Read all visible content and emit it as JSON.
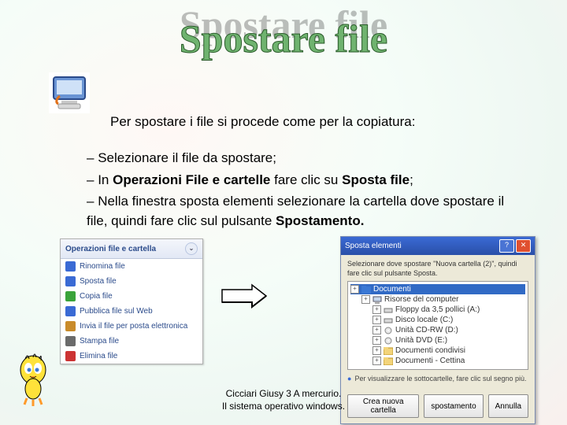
{
  "title": "Spostare file",
  "intro": "Per spostare i file si procede come per la copiatura:",
  "bullets": [
    "Selezionare il file da spostare;",
    "In <b>Operazioni File e cartelle</b> fare clic su <b>Sposta file</b>;",
    "Nella finestra sposta elementi selezionare la cartella dove spostare il file, quindi fare clic sul pulsante <b>Spostamento.</b>"
  ],
  "operations_panel": {
    "title": "Operazioni file e cartella",
    "items": [
      {
        "label": "Rinomina file",
        "color": "#3a6ad4"
      },
      {
        "label": "Sposta file",
        "color": "#3a6ad4"
      },
      {
        "label": "Copia file",
        "color": "#3aa33a"
      },
      {
        "label": "Pubblica file sul Web",
        "color": "#3a6ad4"
      },
      {
        "label": "Invia il file per posta elettronica",
        "color": "#c98b2a"
      },
      {
        "label": "Stampa file",
        "color": "#6a6a6a"
      },
      {
        "label": "Elimina file",
        "color": "#cc3333"
      }
    ]
  },
  "move_dialog": {
    "title": "Sposta elementi",
    "instruction": "Selezionare dove spostare \"Nuova cartella (2)\", quindi fare clic sul pulsante Sposta.",
    "tree": [
      {
        "label": "Documenti",
        "indent": 0,
        "selected": true,
        "icon": "folder-blue"
      },
      {
        "label": "Risorse del computer",
        "indent": 1,
        "icon": "computer"
      },
      {
        "label": "Floppy da 3,5 pollici (A:)",
        "indent": 2,
        "icon": "drive"
      },
      {
        "label": "Disco locale (C:)",
        "indent": 2,
        "icon": "drive"
      },
      {
        "label": "Unità CD-RW (D:)",
        "indent": 2,
        "icon": "cd"
      },
      {
        "label": "Unità DVD (E:)",
        "indent": 2,
        "icon": "cd"
      },
      {
        "label": "Documenti condivisi",
        "indent": 2,
        "icon": "folder"
      },
      {
        "label": "Documenti - Cettina",
        "indent": 2,
        "icon": "folder"
      }
    ],
    "hint": "Per visualizzare le sottocartelle, fare clic sul segno più.",
    "buttons": {
      "new_folder": "Crea nuova cartella",
      "move": "spostamento",
      "cancel": "Annulla"
    }
  },
  "footer": {
    "line1": "Cicciari Giusy 3 A mercurio.",
    "line2": "Il sistema operativo windows."
  }
}
